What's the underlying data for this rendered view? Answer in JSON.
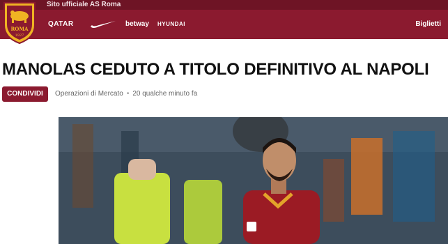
{
  "topbar": {
    "site_label": "Sito ufficiale AS Roma"
  },
  "header": {
    "crest_text": "ROMA",
    "crest_year": "1927",
    "sponsors": {
      "qatar": "QATAR",
      "betway": "betway",
      "hyundai": "HYUNDAI"
    },
    "tickets_label": "Biglietti"
  },
  "article": {
    "headline": "MANOLAS CEDUTO A TITOLO DEFINITIVO AL NAPOLI",
    "share_label": "CONDIVIDI",
    "category": "Operazioni di Mercato",
    "separator": "•",
    "timestamp": "20 qualche minuto fa"
  },
  "colors": {
    "primary": "#8b1a2f",
    "topbar": "#6e1425",
    "gold": "#f0b323"
  },
  "icons": {
    "crest": "roma-crest-icon",
    "nike": "nike-swoosh-icon",
    "tickets": "chevron-down-icon"
  }
}
